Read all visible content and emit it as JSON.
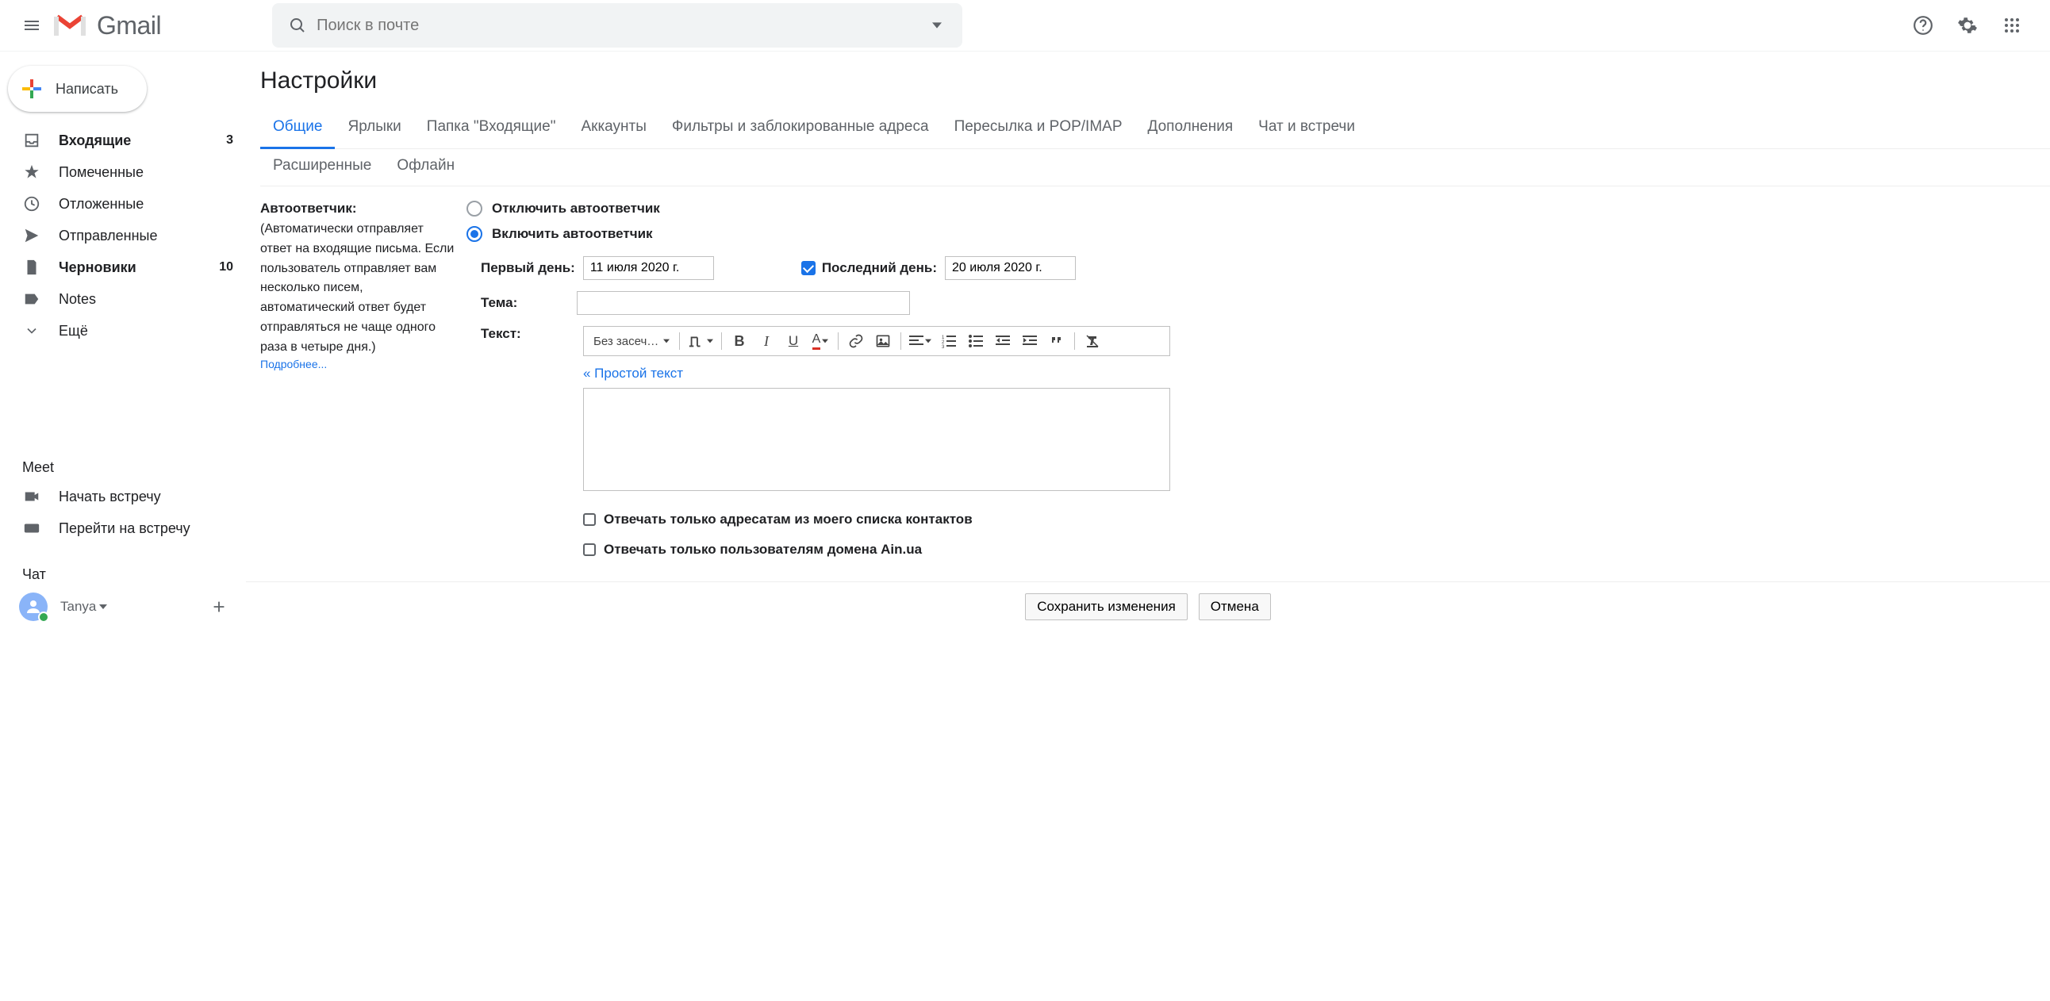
{
  "app": {
    "name": "Gmail"
  },
  "search": {
    "placeholder": "Поиск в почте"
  },
  "compose": {
    "label": "Написать"
  },
  "sidebar": {
    "items": [
      {
        "label": "Входящие",
        "count": "3",
        "bold": true
      },
      {
        "label": "Помеченные"
      },
      {
        "label": "Отложенные"
      },
      {
        "label": "Отправленные"
      },
      {
        "label": "Черновики",
        "count": "10",
        "bold": true
      },
      {
        "label": "Notes"
      },
      {
        "label": "Ещё"
      }
    ]
  },
  "meet": {
    "heading": "Meet",
    "start": "Начать встречу",
    "join": "Перейти на встречу"
  },
  "chat": {
    "heading": "Чат",
    "user": "Tanya"
  },
  "settings": {
    "title": "Настройки",
    "tabs": [
      "Общие",
      "Ярлыки",
      "Папка \"Входящие\"",
      "Аккаунты",
      "Фильтры и заблокированные адреса",
      "Пересылка и POP/IMAP",
      "Дополнения",
      "Чат и встречи"
    ],
    "tabs2": [
      "Расширенные",
      "Офлайн"
    ],
    "autoresponder": {
      "heading": "Автоответчик:",
      "desc": "(Автоматически отправляет ответ на входящие письма. Если пользователь отправляет вам несколько писем, автоматический ответ будет отправляться не чаще одного раза в четыре дня.)",
      "learn_more": "Подробнее...",
      "off_label": "Отключить автоответчик",
      "on_label": "Включить автоответчик",
      "first_day_label": "Первый день:",
      "first_day_value": "11 июля 2020 г.",
      "last_day_label": "Последний день:",
      "last_day_value": "20 июля 2020 г.",
      "subject_label": "Тема:",
      "body_label": "Текст:",
      "font_label": "Без засеч…",
      "plain_text_link": "« Простой текст",
      "contacts_only": "Отвечать только адресатам из моего списка контактов",
      "domain_only": "Отвечать только пользователям домена Ain.ua"
    },
    "buttons": {
      "save": "Сохранить изменения",
      "cancel": "Отмена"
    }
  }
}
